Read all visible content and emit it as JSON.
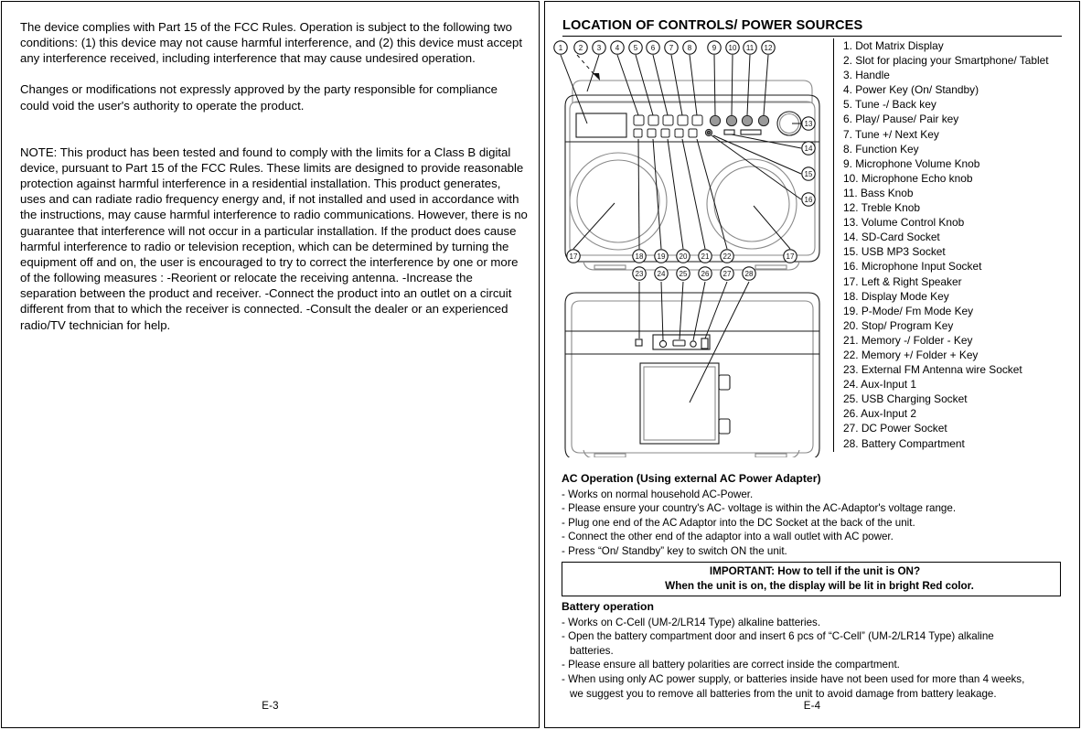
{
  "left_page": {
    "paragraphs": [
      "The device complies with Part 15 of the FCC Rules. Operation is subject to the following two conditions: (1) this device may not cause harmful interference, and (2) this device must accept any interference received, including interference that may cause undesired operation.",
      "Changes or modifications not expressly approved by the party responsible for compliance could void the user's authority to operate the product.",
      "NOTE: This product has been tested and found to comply with the limits for a Class B digital device, pursuant to Part 15 of the FCC Rules. These limits are designed to provide reasonable protection against harmful interference in a residential installation. This product generates, uses and can radiate radio frequency energy and, if not installed and used in accordance with the instructions, may cause harmful interference to radio communications. However, there is no guarantee that interference will not occur in a particular installation. If the product does cause harmful interference to radio or television reception, which can be determined by turning the equipment off and on, the user is encouraged to try to correct the interference by one or more of the following measures : -Reorient or relocate the receiving antenna. -Increase the separation between the product and receiver. -Connect the product into an outlet on a circuit different from that to which the receiver is connected. -Consult the dealer or an experienced radio/TV technician for help."
    ],
    "folio": "E-3"
  },
  "right_page": {
    "title": "LOCATION OF CONTROLS/ POWER SOURCES",
    "folio": "E-4",
    "controls": [
      "1. Dot Matrix Display",
      "2. Slot for placing your Smartphone/ Tablet",
      "3. Handle",
      "4. Power Key (On/ Standby)",
      "5. Tune -/ Back key",
      "6. Play/ Pause/ Pair key",
      "7. Tune +/ Next Key",
      "8. Function Key",
      "9. Microphone Volume Knob",
      "10. Microphone Echo knob",
      "11. Bass Knob",
      "12. Treble Knob",
      "13. Volume Control Knob",
      "14. SD-Card Socket",
      "15. USB MP3 Socket",
      "16. Microphone Input Socket",
      "17. Left & Right Speaker",
      "18. Display Mode Key",
      "19. P-Mode/ Fm Mode Key",
      "20. Stop/ Program Key",
      "21. Memory -/ Folder - Key",
      "22. Memory +/ Folder + Key",
      "23. External FM Antenna wire Socket",
      "24. Aux-Input 1",
      "25. USB Charging Socket",
      "26. Aux-Input 2",
      "27. DC Power Socket",
      "28. Battery Compartment"
    ],
    "callout_labels_top": [
      "1",
      "2",
      "3",
      "4",
      "5",
      "6",
      "7",
      "8",
      "9",
      "10",
      "11",
      "12"
    ],
    "callout_labels_right": [
      "13",
      "14",
      "15",
      "16"
    ],
    "callout_labels_bottom_front": [
      "17",
      "18",
      "19",
      "20",
      "21",
      "22",
      "17"
    ],
    "callout_labels_back": [
      "23",
      "24",
      "25",
      "26",
      "27",
      "28"
    ],
    "ac_section": {
      "heading": "AC Operation (Using external AC Power Adapter)",
      "lines": [
        "- Works on normal household AC-Power.",
        "- Please ensure your country's AC- voltage is within the AC-Adaptor's voltage range.",
        "- Plug one end of the AC Adaptor into the DC Socket at the back of the unit.",
        "- Connect the other end of the adaptor into a wall outlet with AC power.",
        "- Press “On/ Standby” key to switch ON the unit."
      ]
    },
    "important_box": {
      "line1": "IMPORTANT: How to tell if the unit is ON?",
      "line2": "When the unit is on, the display will be lit in bright Red color."
    },
    "battery_section": {
      "heading": "Battery operation",
      "lines": [
        "- Works on C-Cell (UM-2/LR14 Type) alkaline batteries.",
        "- Open the battery compartment door and insert 6 pcs of “C-Cell” (UM-2/LR14 Type) alkaline",
        "batteries.",
        "- Please ensure all battery polarities are correct inside the compartment.",
        "- When using only AC power supply, or batteries inside have not been used for more than 4 weeks,",
        "we suggest you to remove all batteries from the unit to avoid damage from battery leakage."
      ]
    }
  },
  "colors": {
    "ink": "#000000",
    "paper": "#ffffff",
    "line_gray": "#8a8a8a",
    "knob_fill": "#9a9a9a"
  }
}
